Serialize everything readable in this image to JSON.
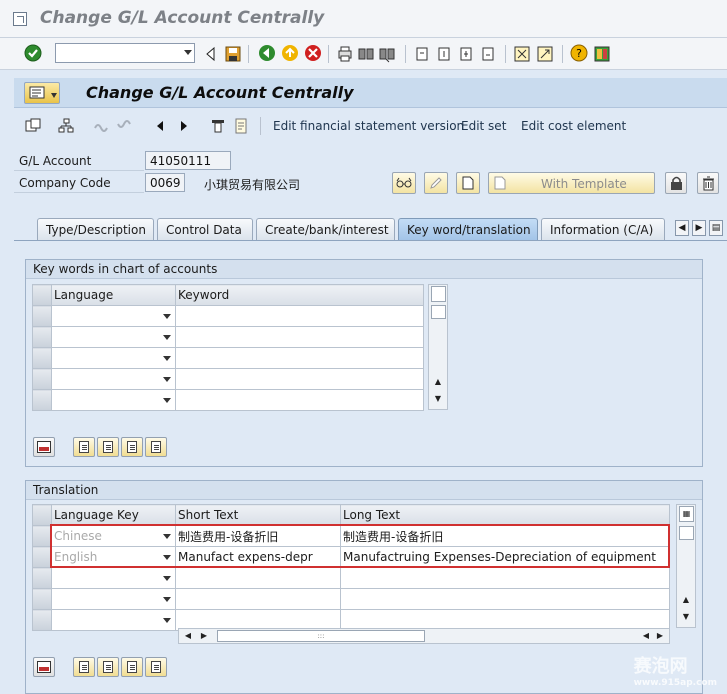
{
  "window": {
    "title": "Change G/L Account Centrally"
  },
  "screen": {
    "title": "Change G/L Account Centrally"
  },
  "appbar": {
    "edit_fs_version": "Edit financial statement version",
    "edit_set": "Edit set",
    "edit_cost_element": "Edit cost element"
  },
  "fields": {
    "gl_account_label": "G/L Account",
    "gl_account_value": "41050111",
    "company_code_label": "Company Code",
    "company_code_value": "0069",
    "company_name": "小琪贸易有限公司"
  },
  "buttons": {
    "with_template": "With Template"
  },
  "tabs": [
    {
      "label": "Type/Description"
    },
    {
      "label": "Control Data"
    },
    {
      "label": "Create/bank/interest"
    },
    {
      "label": "Key word/translation"
    },
    {
      "label": "Information (C/A)"
    }
  ],
  "keywords_group": {
    "title": "Key words in chart of accounts",
    "columns": [
      "Language",
      "Keyword"
    ]
  },
  "translation_group": {
    "title": "Translation",
    "columns": [
      "Language Key",
      "Short Text",
      "Long Text"
    ],
    "rows": [
      {
        "lang": "Chinese",
        "short": "制造费用-设备折旧",
        "long": "制造费用-设备折旧"
      },
      {
        "lang": "English",
        "short": "Manufact expens-depr",
        "long": "Manufactruing Expenses-Depreciation of equipment"
      }
    ]
  },
  "watermark": {
    "text": "赛泡网",
    "url": "www.915ap.com"
  },
  "colors": {
    "highlight": "#d03030",
    "active_tab": "#a3c4e8"
  }
}
